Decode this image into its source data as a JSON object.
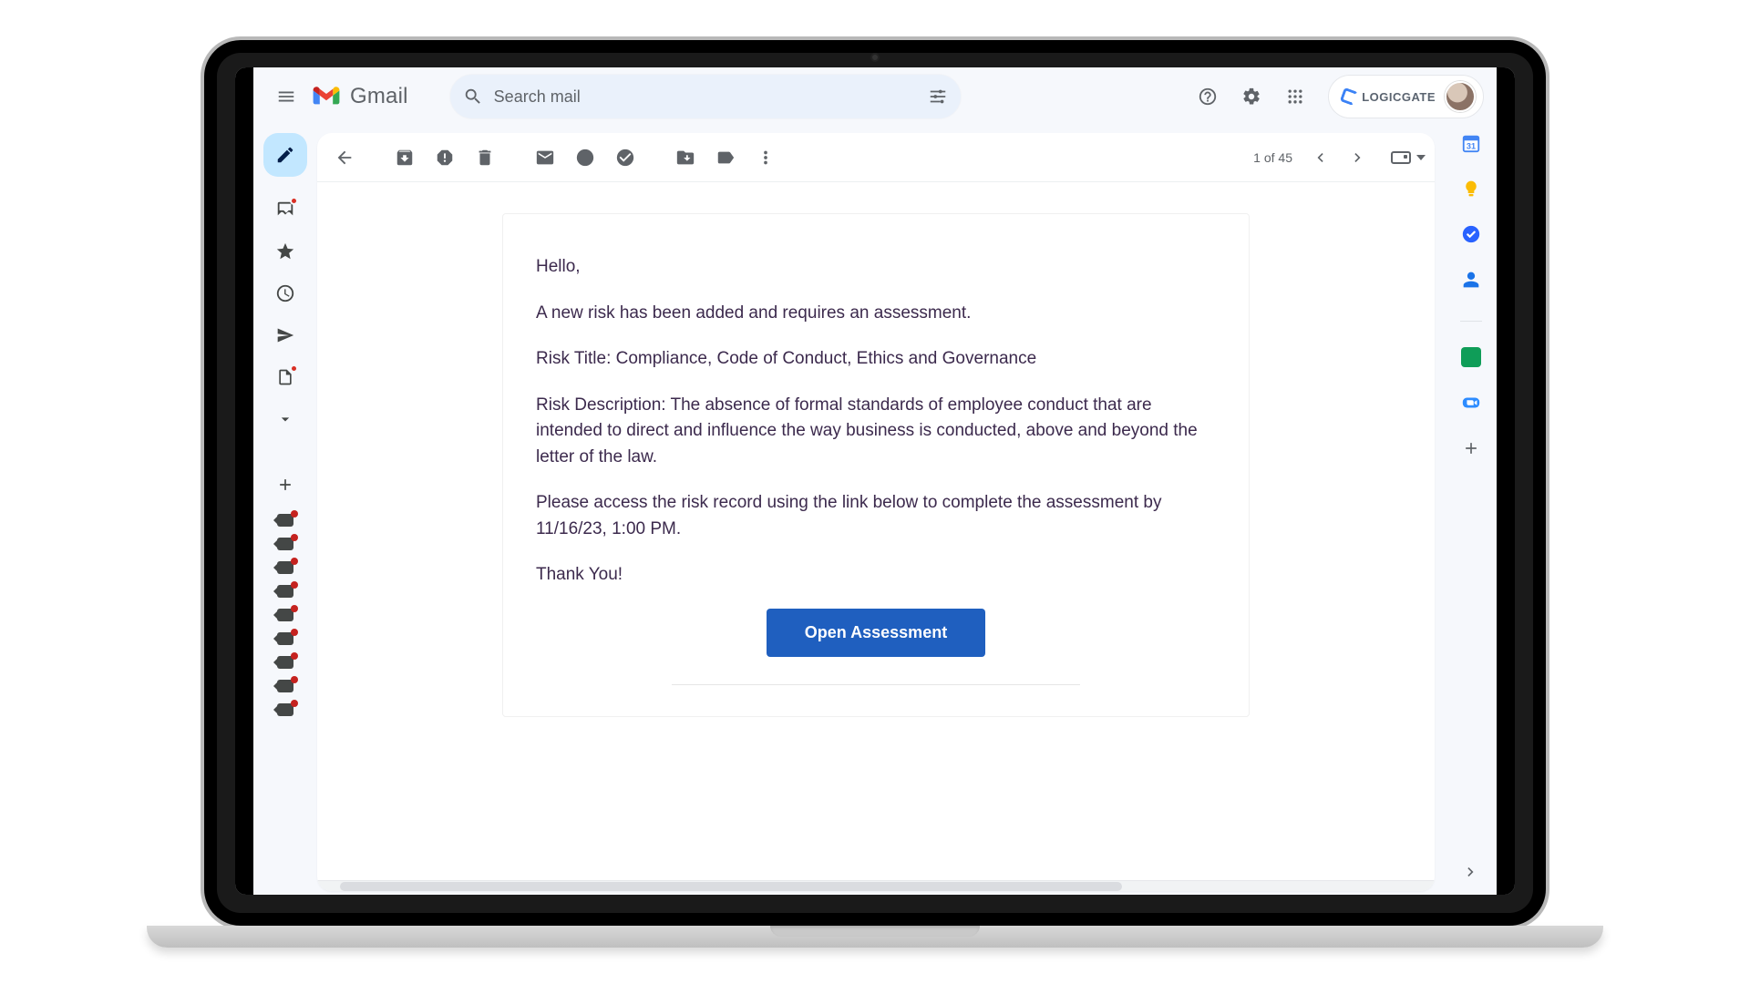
{
  "app": {
    "name": "Gmail"
  },
  "search": {
    "placeholder": "Search mail"
  },
  "brand_chip": {
    "label": "LOGICGATE"
  },
  "pager": {
    "text": "1 of 45"
  },
  "email": {
    "greeting": "Hello,",
    "p_new_risk": "A new risk has been added and requires an assessment.",
    "risk_title": "Risk Title: Compliance, Code of Conduct, Ethics and Governance",
    "risk_description": "Risk Description: The absence of formal standards of employee conduct that are intended to direct and influence the way business is conducted, above and beyond the letter of the law.",
    "deadline_line": "Please access the risk record using the link below to complete the assessment by 11/16/23, 1:00 PM.",
    "thank_you": "Thank You!",
    "cta_label": "Open Assessment"
  },
  "label_count": 9
}
